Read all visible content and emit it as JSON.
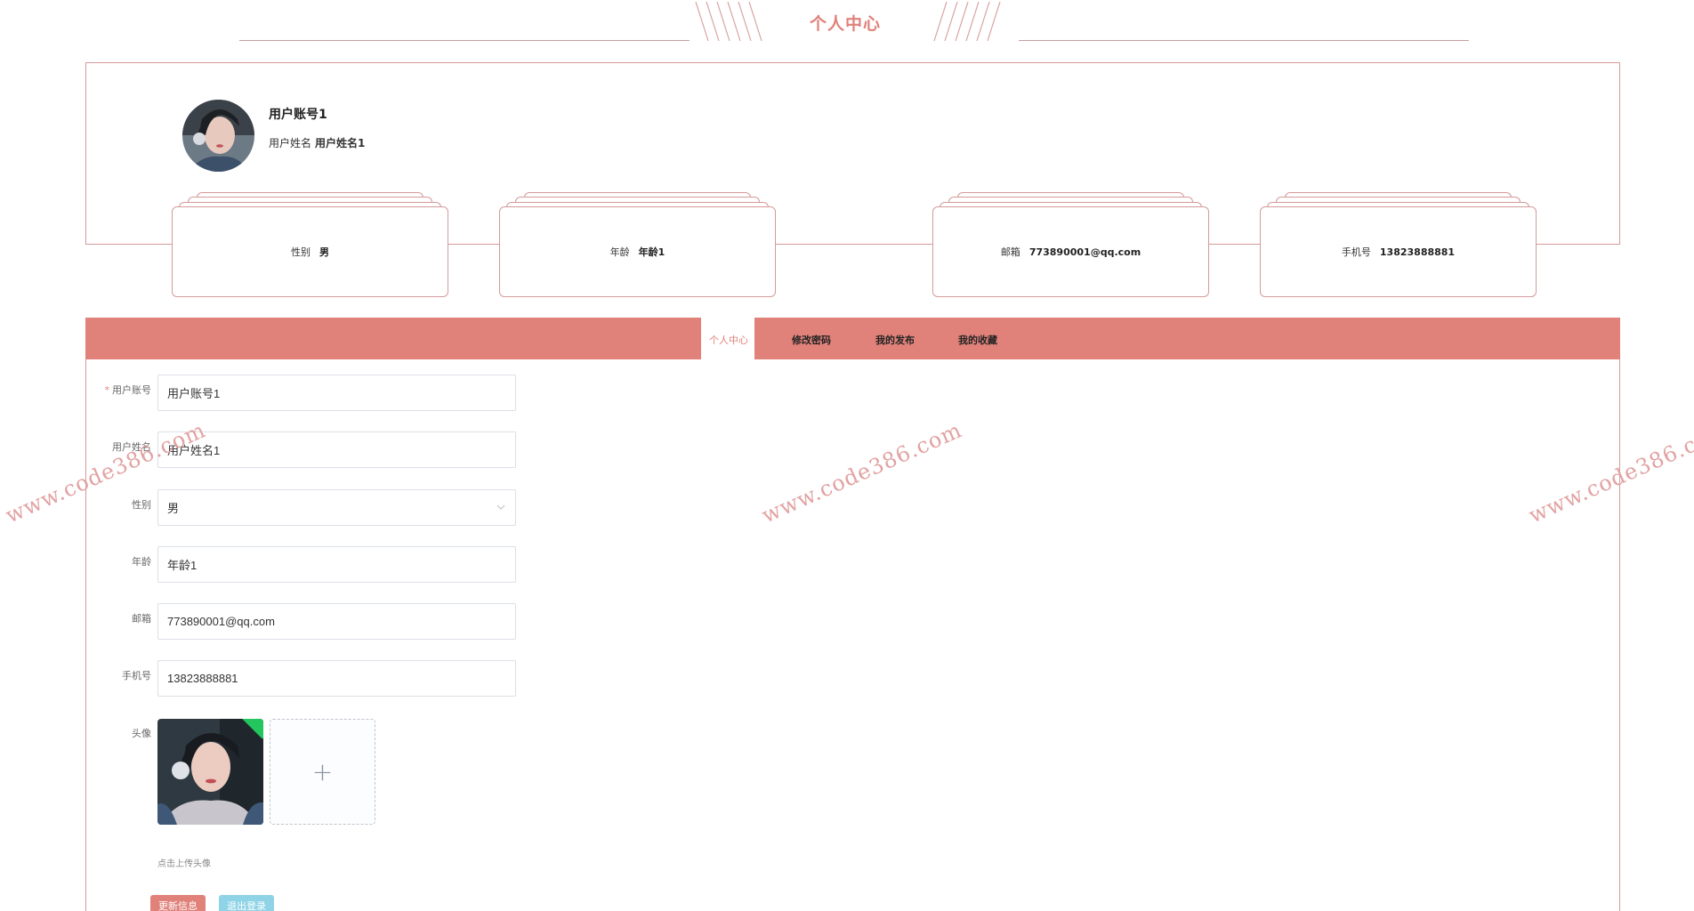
{
  "header": {
    "title": "个人中心"
  },
  "profile": {
    "account": "用户账号1",
    "name_label": "用户姓名",
    "name_value": "用户姓名1",
    "stats": [
      {
        "label": "性别",
        "value": "男"
      },
      {
        "label": "年龄",
        "value": "年龄1"
      },
      {
        "label": "邮箱",
        "value": "773890001@qq.com"
      },
      {
        "label": "手机号",
        "value": "13823888881"
      }
    ]
  },
  "tabs": [
    {
      "label": "个人中心",
      "active": true
    },
    {
      "label": "修改密码"
    },
    {
      "label": "我的发布"
    },
    {
      "label": "我的收藏"
    }
  ],
  "form": {
    "account": {
      "label": "用户账号",
      "value": "用户账号1"
    },
    "name": {
      "label": "用户姓名",
      "value": "用户姓名1"
    },
    "gender": {
      "label": "性别",
      "value": "男"
    },
    "age": {
      "label": "年龄",
      "value": "年龄1"
    },
    "email": {
      "label": "邮箱",
      "value": "773890001@qq.com"
    },
    "phone": {
      "label": "手机号",
      "value": "13823888881"
    },
    "avatar": {
      "label": "头像",
      "add_glyph": "+",
      "tip": "点击上传头像"
    }
  },
  "buttons": {
    "update": "更新信息",
    "logout": "退出登录"
  },
  "watermark": "www.code386.com",
  "colors": {
    "accent": "#e0817a",
    "border": "#d59a9a",
    "logout": "#8fd3e6",
    "success": "#22c55e"
  }
}
